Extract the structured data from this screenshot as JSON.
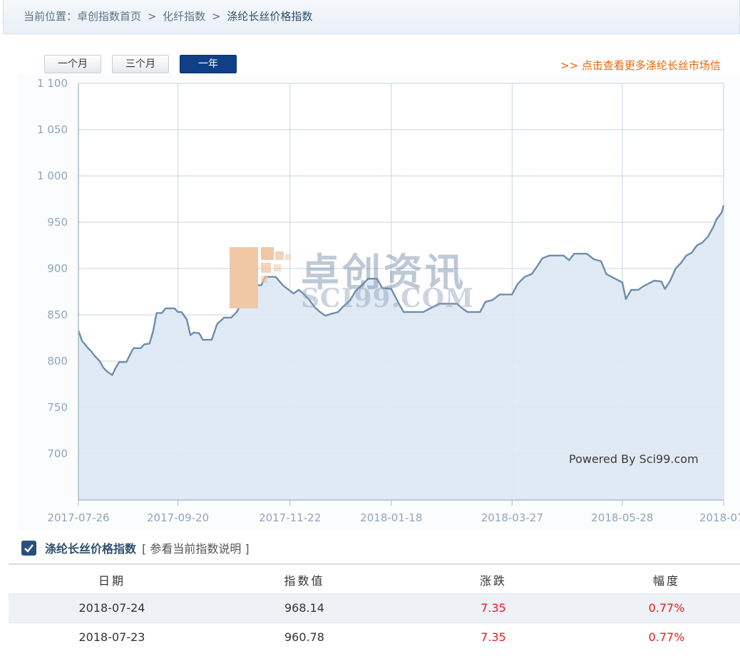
{
  "breadcrumb": {
    "prefix": "当前位置：",
    "items": [
      "卓创指数首页",
      "化纤指数"
    ],
    "current": "涤纶长丝价格指数",
    "separator": ">"
  },
  "range_buttons": [
    {
      "label": "一个月",
      "active": false
    },
    {
      "label": "三个月",
      "active": false
    },
    {
      "label": "一年",
      "active": true
    }
  ],
  "more_link": ">> 点击查看更多涤纶长丝市场信",
  "watermark": {
    "cn": "卓创资讯",
    "en": "SCI99.COM"
  },
  "powered_by": "Powered By Sci99.com",
  "chart_data": {
    "type": "area",
    "ylim": [
      650,
      1100
    ],
    "y_ticks": [
      700,
      750,
      800,
      850,
      900,
      950,
      1000,
      1050,
      1100
    ],
    "y_tick_labels": [
      "700",
      "750",
      "800",
      "850",
      "900",
      "950",
      "1 000",
      "1 050",
      "1 100"
    ],
    "x_tick_labels": [
      "2017-07-26",
      "2017-09-20",
      "2017-11-22",
      "2018-01-18",
      "2018-03-27",
      "2018-05-28",
      "2018-07-"
    ],
    "x_range": [
      "2017-07-26",
      "2018-07-24"
    ],
    "x_tick_dates": [
      "2017-07-26",
      "2017-09-20",
      "2017-11-22",
      "2018-01-18",
      "2018-03-27",
      "2018-05-28",
      "2018-07-24"
    ],
    "grid": true,
    "line_color": "#6f8cab",
    "fill_color": "#dde8f3",
    "series": [
      {
        "values": [
          [
            "2017-07-26",
            833
          ],
          [
            "2017-07-28",
            822
          ],
          [
            "2017-07-31",
            815
          ],
          [
            "2017-08-02",
            811
          ],
          [
            "2017-08-04",
            806
          ],
          [
            "2017-08-07",
            800
          ],
          [
            "2017-08-09",
            793
          ],
          [
            "2017-08-11",
            789
          ],
          [
            "2017-08-14",
            785
          ],
          [
            "2017-08-16",
            793
          ],
          [
            "2017-08-18",
            799
          ],
          [
            "2017-08-22",
            799
          ],
          [
            "2017-08-24",
            807
          ],
          [
            "2017-08-26",
            814
          ],
          [
            "2017-08-30",
            814
          ],
          [
            "2017-09-01",
            818
          ],
          [
            "2017-09-04",
            819
          ],
          [
            "2017-09-06",
            832
          ],
          [
            "2017-09-08",
            852
          ],
          [
            "2017-09-11",
            852
          ],
          [
            "2017-09-13",
            857
          ],
          [
            "2017-09-18",
            857
          ],
          [
            "2017-09-20",
            853
          ],
          [
            "2017-09-22",
            853
          ],
          [
            "2017-09-25",
            845
          ],
          [
            "2017-09-27",
            828
          ],
          [
            "2017-09-29",
            831
          ],
          [
            "2017-10-02",
            830
          ],
          [
            "2017-10-04",
            823
          ],
          [
            "2017-10-09",
            823
          ],
          [
            "2017-10-12",
            840
          ],
          [
            "2017-10-16",
            847
          ],
          [
            "2017-10-20",
            847
          ],
          [
            "2017-10-23",
            853
          ],
          [
            "2017-10-26",
            863
          ],
          [
            "2017-10-30",
            873
          ],
          [
            "2017-11-02",
            882
          ],
          [
            "2017-11-06",
            882
          ],
          [
            "2017-11-08",
            891
          ],
          [
            "2017-11-14",
            891
          ],
          [
            "2017-11-18",
            882
          ],
          [
            "2017-11-20",
            879
          ],
          [
            "2017-11-22",
            876
          ],
          [
            "2017-11-24",
            873
          ],
          [
            "2017-11-27",
            877
          ],
          [
            "2017-11-30",
            872
          ],
          [
            "2017-12-03",
            866
          ],
          [
            "2017-12-06",
            858
          ],
          [
            "2017-12-09",
            853
          ],
          [
            "2017-12-12",
            849
          ],
          [
            "2017-12-15",
            851
          ],
          [
            "2017-12-19",
            853
          ],
          [
            "2017-12-22",
            859
          ],
          [
            "2017-12-26",
            866
          ],
          [
            "2017-12-29",
            876
          ],
          [
            "2018-01-02",
            883
          ],
          [
            "2018-01-05",
            889
          ],
          [
            "2018-01-10",
            889
          ],
          [
            "2018-01-13",
            879
          ],
          [
            "2018-01-18",
            878
          ],
          [
            "2018-01-22",
            863
          ],
          [
            "2018-01-25",
            853
          ],
          [
            "2018-02-05",
            853
          ],
          [
            "2018-02-10",
            858
          ],
          [
            "2018-02-14",
            862
          ],
          [
            "2018-02-24",
            862
          ],
          [
            "2018-02-27",
            857
          ],
          [
            "2018-03-02",
            853
          ],
          [
            "2018-03-09",
            853
          ],
          [
            "2018-03-12",
            864
          ],
          [
            "2018-03-16",
            866
          ],
          [
            "2018-03-20",
            872
          ],
          [
            "2018-03-27",
            872
          ],
          [
            "2018-03-30",
            883
          ],
          [
            "2018-04-03",
            891
          ],
          [
            "2018-04-07",
            894
          ],
          [
            "2018-04-10",
            902
          ],
          [
            "2018-04-13",
            911
          ],
          [
            "2018-04-17",
            914
          ],
          [
            "2018-04-25",
            914
          ],
          [
            "2018-04-28",
            909
          ],
          [
            "2018-05-01",
            916
          ],
          [
            "2018-05-08",
            916
          ],
          [
            "2018-05-12",
            910
          ],
          [
            "2018-05-16",
            908
          ],
          [
            "2018-05-19",
            894
          ],
          [
            "2018-05-24",
            889
          ],
          [
            "2018-05-28",
            885
          ],
          [
            "2018-05-30",
            867
          ],
          [
            "2018-06-02",
            877
          ],
          [
            "2018-06-06",
            877
          ],
          [
            "2018-06-09",
            881
          ],
          [
            "2018-06-12",
            884
          ],
          [
            "2018-06-15",
            887
          ],
          [
            "2018-06-19",
            886
          ],
          [
            "2018-06-21",
            878
          ],
          [
            "2018-06-24",
            887
          ],
          [
            "2018-06-27",
            900
          ],
          [
            "2018-06-30",
            906
          ],
          [
            "2018-07-03",
            914
          ],
          [
            "2018-07-06",
            917
          ],
          [
            "2018-07-09",
            925
          ],
          [
            "2018-07-12",
            928
          ],
          [
            "2018-07-15",
            934
          ],
          [
            "2018-07-18",
            944
          ],
          [
            "2018-07-20",
            953
          ],
          [
            "2018-07-23",
            960.78
          ],
          [
            "2018-07-24",
            968.14
          ]
        ]
      }
    ]
  },
  "legend": {
    "series_name": "涤纶长丝价格指数",
    "explain_link": "[ 参看当前指数说明 ]"
  },
  "table": {
    "headers": [
      "日期",
      "指数值",
      "涨跌",
      "幅度"
    ],
    "rows": [
      {
        "date": "2018-07-24",
        "value": "968.14",
        "change": "7.35",
        "pct": "0.77%"
      },
      {
        "date": "2018-07-23",
        "value": "960.78",
        "change": "7.35",
        "pct": "0.77%"
      }
    ]
  }
}
